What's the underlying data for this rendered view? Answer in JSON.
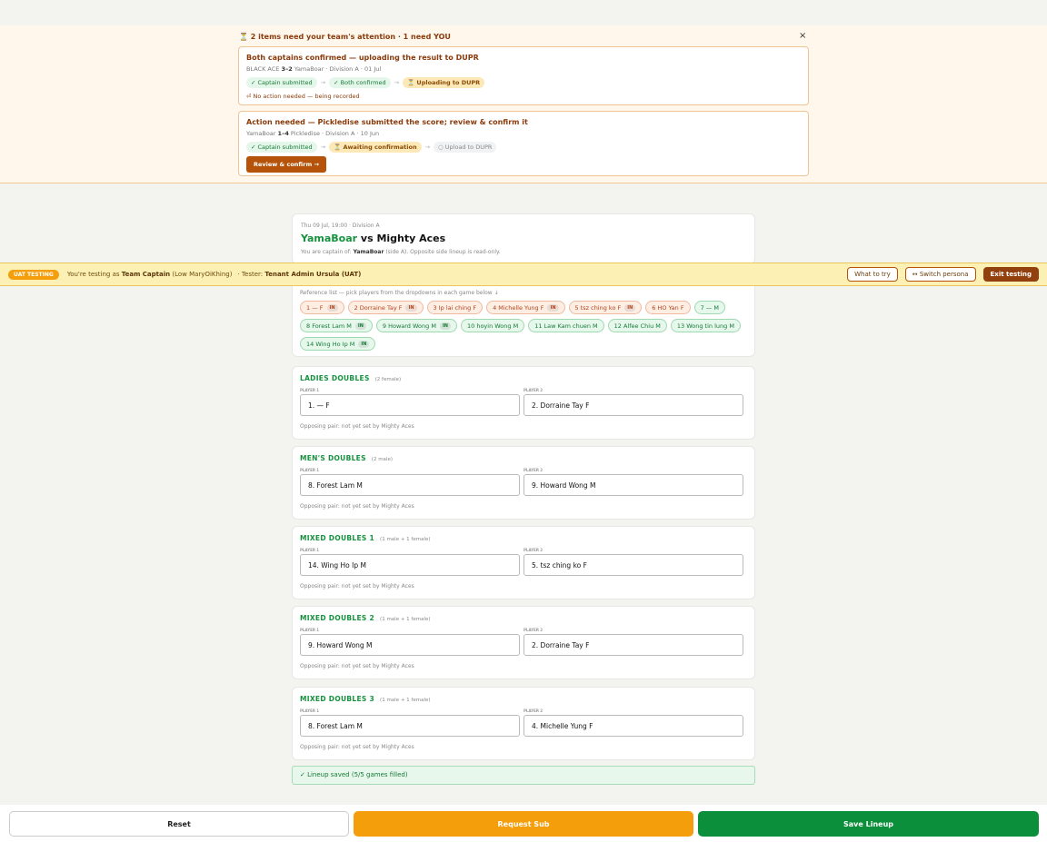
{
  "attention": {
    "header": "⏳ 2 items need your team's attention · 1 need YOU",
    "close": "×",
    "items": [
      {
        "title": "Both captains confirmed — uploading the result to DUPR",
        "meta_pre": "BLACK ACE",
        "meta_score": "3–2",
        "meta_post": "YamaBoar · Division A · 01 Jul",
        "steps": [
          "✓ Captain submitted",
          "✓ Both confirmed",
          "⏳ Uploading to DUPR"
        ],
        "note": "⏎ No action needed — being recorded"
      },
      {
        "title": "Action needed — Pickledise submitted the score; review & confirm it",
        "meta_pre": "YamaBoar",
        "meta_score": "1–4",
        "meta_post": "Pickledise · Division A · 10 Jun",
        "steps": [
          "✓ Captain submitted",
          "⏳ Awaiting confirmation",
          "○ Upload to DUPR"
        ],
        "button": "Review & confirm →"
      }
    ],
    "arrow": "→"
  },
  "match": {
    "meta": "Thu 09 Jul, 19:00 · Division A",
    "home": "YamaBoar",
    "vs": " vs Mighty Aces",
    "cap_pre": "You are captain of: ",
    "cap_team": "YamaBoar",
    "cap_post": " (side A). Opposite side lineup is read-only."
  },
  "uat": {
    "badge": "UAT TESTING",
    "pre": "You're testing as ",
    "role": "Team Captain",
    "who": " (Low MaryOiKhing)",
    "tester_pre": "· Tester: ",
    "tester": "Tenant Admin Ursula (UAT)",
    "btn_try": "What to try",
    "btn_switch": "↔ Switch persona",
    "btn_exit": "Exit testing"
  },
  "roster": {
    "ref": "Reference list — pick players from the dropdowns in each game below ↓",
    "in_label": "IN",
    "players": [
      {
        "label": "1 — F",
        "g": "f",
        "in": true
      },
      {
        "label": "2 Dorraine Tay F",
        "g": "f",
        "in": true
      },
      {
        "label": "3 Ip lai ching F",
        "g": "f",
        "in": false
      },
      {
        "label": "4 Michelle Yung F",
        "g": "f",
        "in": true
      },
      {
        "label": "5 tsz ching ko F",
        "g": "f",
        "in": true
      },
      {
        "label": "6 HO Yan F",
        "g": "f",
        "in": false
      },
      {
        "label": "7 — M",
        "g": "m",
        "in": false
      },
      {
        "label": "8 Forest Lam M",
        "g": "m",
        "in": true
      },
      {
        "label": "9 Howard Wong M",
        "g": "m",
        "in": true
      },
      {
        "label": "10 hoyin Wong M",
        "g": "m",
        "in": false
      },
      {
        "label": "11 Law Kam chuen M",
        "g": "m",
        "in": false
      },
      {
        "label": "12 Alfee Chiu M",
        "g": "m",
        "in": false
      },
      {
        "label": "13 Wong tin lung M",
        "g": "m",
        "in": false
      },
      {
        "label": "14 Wing Ho Ip M",
        "g": "m",
        "in": true
      }
    ]
  },
  "games": [
    {
      "name": "LADIES DOUBLES",
      "sub": "(2 female)",
      "p1": "1. — F",
      "p2": "2. Dorraine Tay F"
    },
    {
      "name": "MEN'S DOUBLES",
      "sub": "(2 male)",
      "p1": "8. Forest Lam M",
      "p2": "9. Howard Wong M"
    },
    {
      "name": "MIXED DOUBLES 1",
      "sub": "(1 male + 1 female)",
      "p1": "14. Wing Ho Ip M",
      "p2": "5. tsz ching ko F"
    },
    {
      "name": "MIXED DOUBLES 2",
      "sub": "(1 male + 1 female)",
      "p1": "9. Howard Wong M",
      "p2": "2. Dorraine Tay F"
    },
    {
      "name": "MIXED DOUBLES 3",
      "sub": "(1 male + 1 female)",
      "p1": "8. Forest Lam M",
      "p2": "4. Michelle Yung F"
    }
  ],
  "labels": {
    "player1": "PLAYER 1",
    "player2": "PLAYER 2",
    "opposing": "Opposing pair: not yet set by Mighty Aces"
  },
  "saved": "✓ Lineup saved (5/5 games filled)",
  "actions": {
    "reset": "Reset",
    "request_sub": "Request Sub",
    "save": "Save Lineup"
  }
}
